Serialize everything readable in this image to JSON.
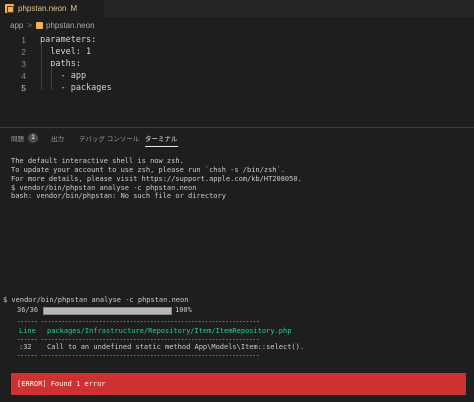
{
  "tab": {
    "filename": "phpstan.neon",
    "modified_marker": "M"
  },
  "breadcrumb": {
    "folder": "app",
    "separator": ">",
    "file": "phpstan.neon"
  },
  "editor": {
    "lines": [
      {
        "number": "1",
        "text": "parameters:"
      },
      {
        "number": "2",
        "text": "  level: 1"
      },
      {
        "number": "3",
        "text": "  paths:"
      },
      {
        "number": "4",
        "text": "    - app"
      },
      {
        "number": "5",
        "text": "    - packages"
      }
    ]
  },
  "panel": {
    "tabs": [
      {
        "label": "問題",
        "badge": "1"
      },
      {
        "label": "出力"
      },
      {
        "label": "デバッグ コンソール"
      },
      {
        "label": "ターミナル"
      }
    ]
  },
  "terminal": {
    "intro": [
      "The default interactive shell is now zsh.",
      "To update your account to use zsh, please run `chsh -s /bin/zsh`.",
      "For more details, please visit https://support.apple.com/kb/HT208050."
    ],
    "cmd1": "$ vendor/bin/phpstan analyse -c phpstan.neon",
    "cmd1_error": "bash: vendor/bin/phpstan: No such file or directory",
    "cmd2": "$ vendor/bin/phpstan analyse -c phpstan.neon",
    "progress_count": "36/36",
    "progress_percent": "100%",
    "progress_fraction": 1.0,
    "table_rule": "------ ----------------------------------------------------------------",
    "table_header_col1": "Line",
    "table_header_col2": "packages/Infrastructure/Repository/Item/ItemRepository.php",
    "row_line": ":32",
    "row_message": "Call to an undefined static method App\\Models\\Item::select().",
    "error_summary": "[ERROR] Found 1 error"
  },
  "colors": {
    "terminal_bg": "#1e1e1e",
    "error_bg": "#cd3131",
    "header_green": "#23d18b",
    "tab_text": "#e2c08d"
  }
}
